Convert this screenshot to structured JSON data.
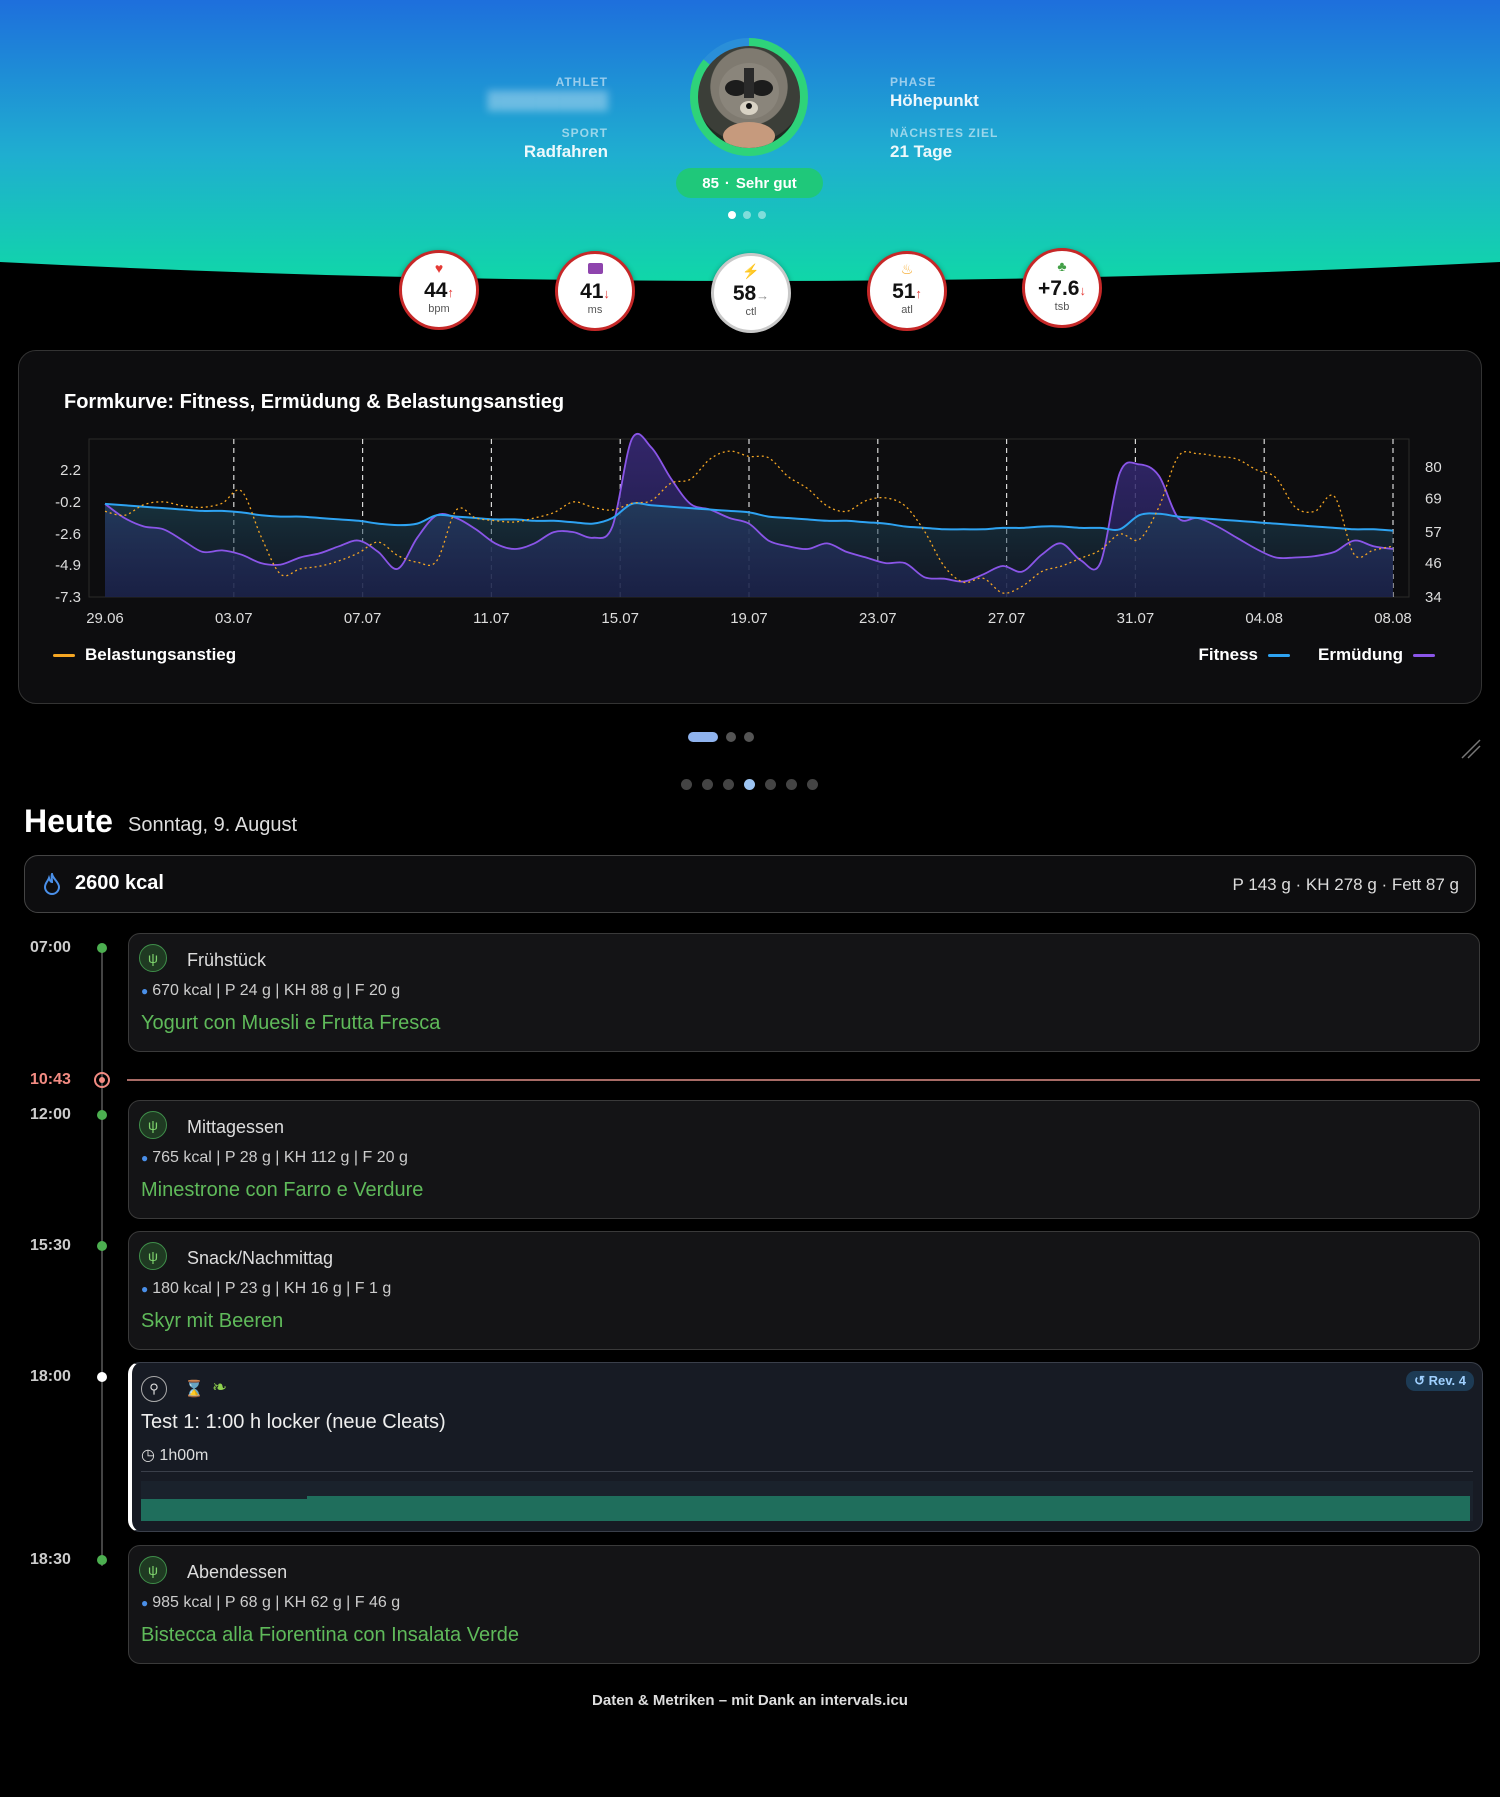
{
  "header": {
    "athlete_label": "ATHLET",
    "sport_label": "SPORT",
    "sport_value": "Radfahren",
    "phase_label": "PHASE",
    "phase_value": "Höhepunkt",
    "next_goal_label": "NÄCHSTES ZIEL",
    "next_goal_value": "21 Tage",
    "score_value": "85",
    "score_separator": "·",
    "score_text": "Sehr gut",
    "carousel_active": 1,
    "carousel_count": 3,
    "score_ring_fraction": 0.85
  },
  "metrics": [
    {
      "icon": "heart-icon",
      "glyph": "♥",
      "value": "44",
      "arrow": "↑",
      "unit": "bpm",
      "icon_color": "#e53935",
      "arrow_color": "#e53935"
    },
    {
      "icon": "pulse-icon",
      "glyph": "▭",
      "value": "41",
      "arrow": "↓",
      "unit": "ms",
      "icon_color": "#8e44ad",
      "arrow_color": "#e53935"
    },
    {
      "icon": "bolt-icon",
      "glyph": "⚡",
      "value": "58",
      "arrow": "→",
      "unit": "ctl",
      "icon_color": "#f5a623",
      "arrow_color": "#888888"
    },
    {
      "icon": "flame-icon",
      "glyph": "♨",
      "value": "51",
      "arrow": "↑",
      "unit": "atl",
      "icon_color": "#f5a623",
      "arrow_color": "#e53935"
    },
    {
      "icon": "sprout-icon",
      "glyph": "♣",
      "value": "+7.6",
      "arrow": "↓",
      "unit": "tsb",
      "icon_color": "#43a047",
      "arrow_color": "#e53935"
    }
  ],
  "chart_card": {
    "title": "Formkurve: Fitness, Ermüdung & Belastungsanstieg",
    "legend_belastung": "Belastungsanstieg",
    "legend_fitness": "Fitness",
    "legend_ermuedung": "Ermüdung"
  },
  "chart_data": {
    "type": "line",
    "x_ticks": [
      "29.06",
      "03.07",
      "07.07",
      "11.07",
      "15.07",
      "19.07",
      "23.07",
      "27.07",
      "31.07",
      "04.08",
      "08.08"
    ],
    "y_left_ticks": [
      "2.2",
      "-0.2",
      "-2.6",
      "-4.9",
      "-7.3"
    ],
    "y_left_range": [
      -7.3,
      4.5
    ],
    "y_right_ticks": [
      "80",
      "69",
      "57",
      "46",
      "34"
    ],
    "y_right_range": [
      34,
      90
    ],
    "grid": "vertical dashed",
    "legend_placement": [
      "bottom-left",
      "bottom-right"
    ],
    "series": [
      {
        "name": "Belastungsanstieg",
        "axis": "left",
        "style": "dotted",
        "color": "#f5a623",
        "values": [
          -0.9,
          -1.2,
          -0.4,
          -0.2,
          -0.5,
          -0.6,
          -0.3,
          0.6,
          -2.8,
          -5.6,
          -5.2,
          -5.0,
          -4.6,
          -4.0,
          -3.2,
          -4.2,
          -4.7,
          -4.6,
          -0.8,
          -1.4,
          -1.6,
          -1.7,
          -1.4,
          -1.0,
          -0.2,
          -0.6,
          -0.8,
          -0.3,
          -0.1,
          1.2,
          1.5,
          3.0,
          3.6,
          3.2,
          3.1,
          1.7,
          0.8,
          -0.5,
          -0.9,
          -0.1,
          0.1,
          -0.5,
          -2.4,
          -5.0,
          -6.2,
          -5.9,
          -7.0,
          -6.5,
          -5.4,
          -5.0,
          -4.4,
          -3.8,
          -2.6,
          -3.0,
          -0.6,
          3.2,
          3.4,
          3.2,
          3.0,
          2.2,
          1.6,
          -0.6,
          -0.9,
          0.2,
          -4.1,
          -3.8,
          -3.5
        ]
      },
      {
        "name": "Fitness",
        "axis": "right",
        "color": "#2ea3f2",
        "values": [
          67,
          66.5,
          66,
          65.5,
          65,
          64.5,
          64.5,
          64,
          63,
          62.5,
          62.5,
          62,
          61.5,
          61,
          60,
          59.5,
          60,
          63,
          62.5,
          62,
          61.5,
          61.5,
          61,
          61,
          60.5,
          60,
          62,
          67,
          66.5,
          66,
          65.5,
          65,
          64.5,
          64,
          62.5,
          62,
          61.5,
          61,
          61,
          60.5,
          60,
          59,
          58.5,
          58,
          58,
          58,
          58.5,
          58.5,
          59,
          59,
          58.5,
          58.5,
          58,
          63,
          63.5,
          62.5,
          62,
          61.5,
          61,
          60.5,
          60,
          59.5,
          59,
          58.5,
          58,
          58,
          57.5
        ]
      },
      {
        "name": "Ermüdung",
        "axis": "right",
        "color": "#8a55e8",
        "values": [
          67,
          62,
          59,
          58,
          54,
          50,
          50.5,
          49,
          46,
          45.5,
          48,
          49.5,
          52,
          54,
          50,
          44,
          55,
          63,
          62,
          58,
          53,
          51,
          53,
          57,
          57,
          55,
          59,
          90,
          87,
          76,
          67,
          65,
          62,
          60,
          54,
          52,
          51,
          53,
          50,
          48,
          46,
          46,
          41,
          40.5,
          39.5,
          42,
          45,
          43,
          49,
          53,
          47,
          46,
          78,
          81,
          77,
          62,
          62,
          59,
          55,
          51,
          48,
          48,
          48.5,
          50,
          54,
          52,
          51
        ]
      }
    ]
  },
  "pagers": {
    "chart_active": 0,
    "chart_count": 3,
    "section_active": 3,
    "section_count": 7
  },
  "today": {
    "title": "Heute",
    "date": "Sonntag, 9. August",
    "kcal": "2600 kcal",
    "macros": "P 143 g · KH 278 g · Fett 87 g"
  },
  "now_time": "10:43",
  "meals": [
    {
      "time": "07:00",
      "name": "Frühstück",
      "macros": "670 kcal | P 24 g | KH 88 g | F 20 g",
      "dish": "Yogurt con Muesli e Frutta Fresca"
    },
    {
      "time": "12:00",
      "name": "Mittagessen",
      "macros": "765 kcal | P 28 g | KH 112 g | F 20 g",
      "dish": "Minestrone con Farro e Verdure"
    },
    {
      "time": "15:30",
      "name": "Snack/Nachmittag",
      "macros": "180 kcal | P 23 g | KH 16 g | F 1 g",
      "dish": "Skyr mit Beeren"
    },
    {
      "time": "18:30",
      "name": "Abendessen",
      "macros": "985 kcal | P 68 g | KH 62 g | F 46 g",
      "dish": "Bistecca alla Fiorentina con Insalata Verde"
    }
  ],
  "workout": {
    "time": "18:00",
    "title": "Test 1: 1:00 h locker (neue Cleats)",
    "duration": "1h00m",
    "revision": "Rev. 4",
    "icons": [
      "bike-icon",
      "hourglass-icon",
      "pepper-icon"
    ],
    "bar_color": "#1f6e5c"
  },
  "footer": "Daten & Metriken – mit Dank an intervals.icu"
}
